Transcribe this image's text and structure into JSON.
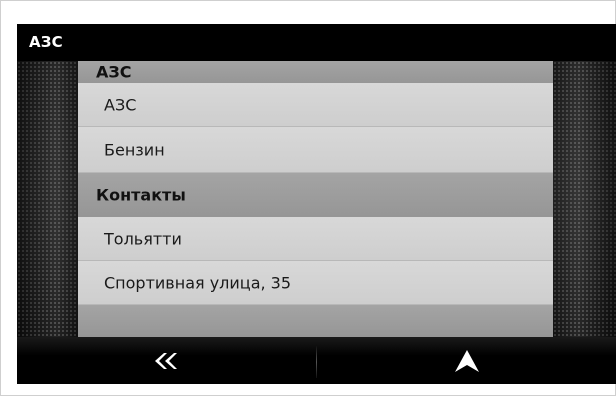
{
  "window": {
    "title": "АЗС"
  },
  "list": {
    "rows": [
      {
        "type": "header",
        "label": "АЗС"
      },
      {
        "type": "item",
        "label": "АЗС"
      },
      {
        "type": "item",
        "label": "Бензин"
      },
      {
        "type": "header",
        "label": "Контакты"
      },
      {
        "type": "item",
        "label": "Тольятти"
      },
      {
        "type": "item",
        "label": "Спортивная улица, 35"
      },
      {
        "type": "header",
        "label": ""
      }
    ]
  },
  "bottom_bar": {
    "back_icon": "double-chevron-left-icon",
    "navigate_icon": "navigation-arrow-icon"
  },
  "colors": {
    "header_row": "#9c9c9c",
    "item_row": "#d3d3d3",
    "bar": "#000000"
  }
}
